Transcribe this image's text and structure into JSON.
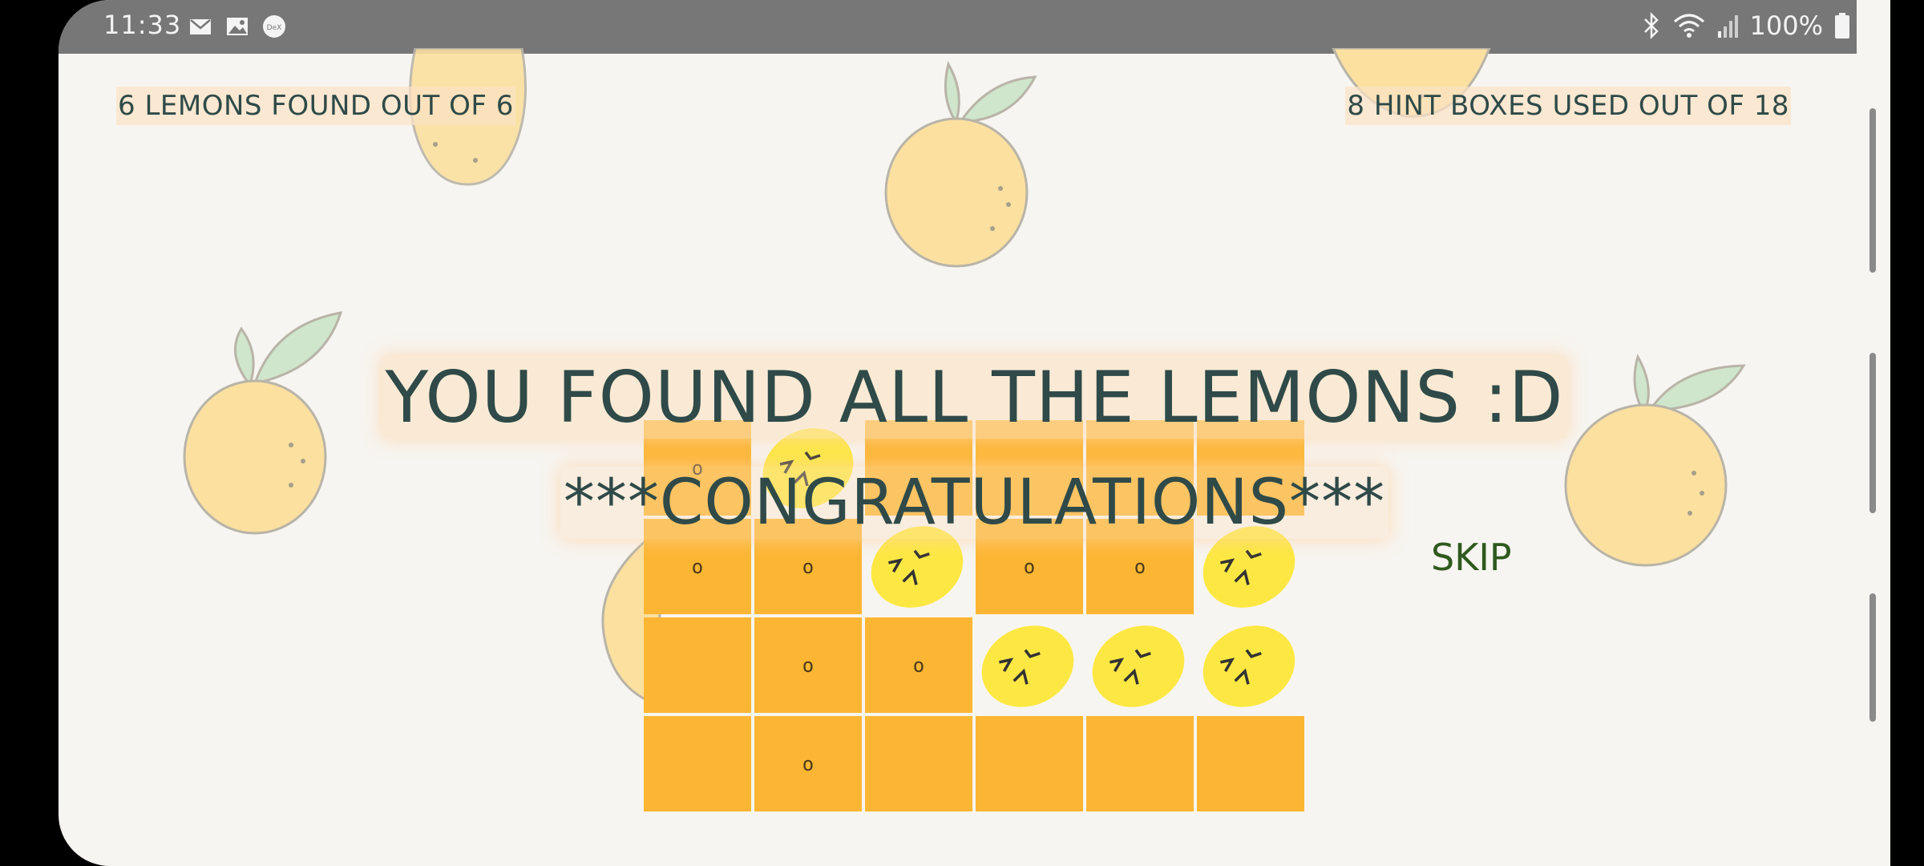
{
  "status_bar": {
    "time": "11:33",
    "left_icons": [
      "mail-icon",
      "image-icon",
      "dex-icon"
    ],
    "battery_pct": "100%",
    "right_icons": [
      "bluetooth-icon",
      "wifi-icon",
      "signal-icon",
      "battery-icon"
    ]
  },
  "game": {
    "lemons_found": "6 LEMONS FOUND OUT OF 6",
    "hints_used": "8 HINT BOXES USED OUT OF 18",
    "title_line1": "YOU FOUND ALL THE LEMONS :D",
    "title_line2": "***CONGRATULATIONS***",
    "skip_label": "SKIP",
    "grid": [
      [
        "o",
        "lemon",
        "",
        "",
        "",
        ""
      ],
      [
        "o",
        "o",
        "lemon",
        "o",
        "o",
        "lemon"
      ],
      [
        "",
        "o",
        "o",
        "lemon",
        "lemon",
        "lemon"
      ],
      [
        "",
        "o",
        "",
        "",
        "",
        ""
      ]
    ],
    "cell_labels": {
      "r0c0": "o",
      "r1c0": "o",
      "r1c1": "o",
      "r1c3": "o",
      "r1c4": "o",
      "r2c1": "o",
      "r2c2": "o",
      "r3c1": "o"
    }
  },
  "colors": {
    "cell": "#fdb633",
    "lemon": "#fde843",
    "text": "#2f4a48",
    "skip": "#2f5a1e",
    "status_bar": "#777777"
  }
}
